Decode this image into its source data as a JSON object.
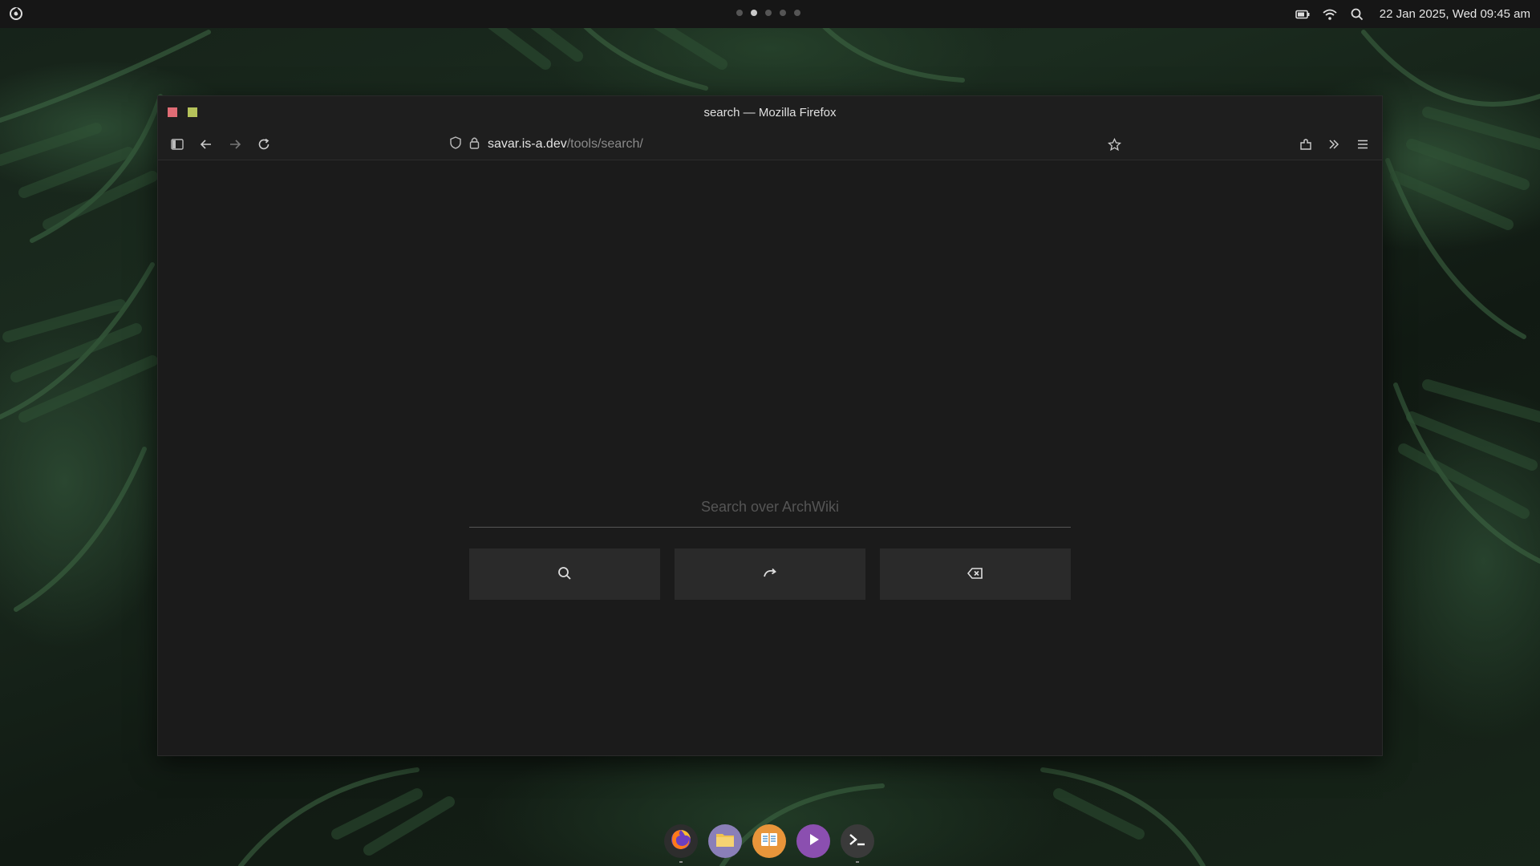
{
  "topbar": {
    "workspaces": [
      {
        "active": false
      },
      {
        "active": true
      },
      {
        "active": false
      },
      {
        "active": false
      },
      {
        "active": false
      }
    ],
    "clock": "22 Jan 2025, Wed  09:45 am",
    "icons": [
      "battery-icon",
      "wifi-icon",
      "search-icon"
    ]
  },
  "window": {
    "title": "search — Mozilla Firefox",
    "url_host": "savar.is-a.dev",
    "url_path": "/tools/search/"
  },
  "page": {
    "search_placeholder": "Search over ArchWiki",
    "search_value": "",
    "buttons": [
      "search-icon",
      "redo-icon",
      "backspace-icon"
    ]
  },
  "dock": {
    "apps": [
      {
        "name": "firefox",
        "color": "#2d2d2d",
        "running": true
      },
      {
        "name": "files",
        "color": "#8a7fb8",
        "running": false
      },
      {
        "name": "reader",
        "color": "#e8953a",
        "running": false
      },
      {
        "name": "media-player",
        "color": "#8b4fb0",
        "running": false
      },
      {
        "name": "terminal",
        "color": "#3a3a3a",
        "running": true
      }
    ]
  },
  "colors": {
    "close": "#e06c75",
    "maximize": "#b5c25a",
    "window_bg": "#1b1b1b",
    "button_bg": "#2a2a2a"
  }
}
